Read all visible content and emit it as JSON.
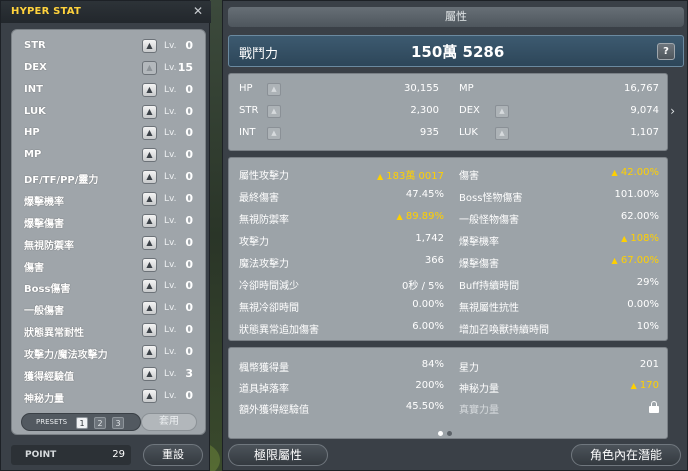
{
  "hyper_stat": {
    "title": "HYPER STAT",
    "lv_label": "Lv.",
    "stats": [
      {
        "name": "STR",
        "level": "0",
        "enabled": true
      },
      {
        "name": "DEX",
        "level": "15",
        "enabled": false
      },
      {
        "name": "INT",
        "level": "0",
        "enabled": true
      },
      {
        "name": "LUK",
        "level": "0",
        "enabled": true
      },
      {
        "name": "HP",
        "level": "0",
        "enabled": true
      },
      {
        "name": "MP",
        "level": "0",
        "enabled": true
      },
      {
        "name": "DF/TF/PP/靈力",
        "level": "0",
        "enabled": true
      },
      {
        "name": "爆擊機率",
        "level": "0",
        "enabled": true
      },
      {
        "name": "爆擊傷害",
        "level": "0",
        "enabled": true
      },
      {
        "name": "無視防禦率",
        "level": "0",
        "enabled": true
      },
      {
        "name": "傷害",
        "level": "0",
        "enabled": true
      },
      {
        "name": "Boss傷害",
        "level": "0",
        "enabled": true
      },
      {
        "name": "一般傷害",
        "level": "0",
        "enabled": true
      },
      {
        "name": "狀態異常耐性",
        "level": "0",
        "enabled": true
      },
      {
        "name": "攻擊力/魔法攻擊力",
        "level": "0",
        "enabled": true
      },
      {
        "name": "獲得經驗值",
        "level": "3",
        "enabled": true
      },
      {
        "name": "神秘力量",
        "level": "0",
        "enabled": true
      }
    ],
    "presets_label": "PRESETS",
    "presets": [
      "1",
      "2",
      "3"
    ],
    "active_preset": "1",
    "apply_label": "套用",
    "point_label": "POINT",
    "point_value": "29",
    "reset_label": "重設"
  },
  "attr": {
    "title": "屬性",
    "combat_power_label": "戰鬥力",
    "combat_power_value": "150萬 5286",
    "help_label": "?",
    "basic": {
      "hp_label": "HP",
      "hp_value": "30,155",
      "mp_label": "MP",
      "mp_value": "16,767",
      "str_label": "STR",
      "str_value": "2,300",
      "dex_label": "DEX",
      "dex_value": "9,074",
      "int_label": "INT",
      "int_value": "935",
      "luk_label": "LUK",
      "luk_value": "1,107"
    },
    "detail": [
      {
        "l_label": "屬性攻擊力",
        "l_value": "183萬 0017",
        "l_up": true,
        "r_label": "傷害",
        "r_value": "42.00%",
        "r_up": true
      },
      {
        "l_label": "最終傷害",
        "l_value": "47.45%",
        "l_up": false,
        "r_label": "Boss怪物傷害",
        "r_value": "101.00%",
        "r_up": false
      },
      {
        "l_label": "無視防禦率",
        "l_value": "89.89%",
        "l_up": true,
        "r_label": "一般怪物傷害",
        "r_value": "62.00%",
        "r_up": false
      },
      {
        "l_label": "攻擊力",
        "l_value": "1,742",
        "l_up": false,
        "r_label": "爆擊機率",
        "r_value": "108%",
        "r_up": true
      },
      {
        "l_label": "魔法攻擊力",
        "l_value": "366",
        "l_up": false,
        "r_label": "爆擊傷害",
        "r_value": "67.00%",
        "r_up": true
      },
      {
        "l_label": "冷卻時間減少",
        "l_value": "0秒 / 5%",
        "l_up": false,
        "r_label": "Buff持續時間",
        "r_value": "29%",
        "r_up": false
      },
      {
        "l_label": "無視冷卻時間",
        "l_value": "0.00%",
        "l_up": false,
        "r_label": "無視屬性抗性",
        "r_value": "0.00%",
        "r_up": false
      },
      {
        "l_label": "狀態異常追加傷害",
        "l_value": "6.00%",
        "l_up": false,
        "r_label": "增加召喚獸持續時間",
        "r_value": "10%",
        "r_up": false
      }
    ],
    "extra": [
      {
        "l_label": "楓幣獲得量",
        "l_value": "84%",
        "r_label": "星力",
        "r_value": "201",
        "r_up": false
      },
      {
        "l_label": "道具掉落率",
        "l_value": "200%",
        "r_label": "神秘力量",
        "r_value": "170",
        "r_up": true
      },
      {
        "l_label": "額外獲得經驗值",
        "l_value": "45.50%",
        "r_label": "真實力量",
        "r_value": "",
        "r_up": false
      }
    ],
    "up_marker": "▲",
    "next_arrow": "›",
    "ability_button": "極限屬性",
    "inner_button": "角色內在潛能"
  },
  "colors": {
    "gold": "#ffd000",
    "title_yellow": "#ffd23c",
    "panel_gray": "#9ca3a8",
    "combat_blue": "#2d4659"
  }
}
